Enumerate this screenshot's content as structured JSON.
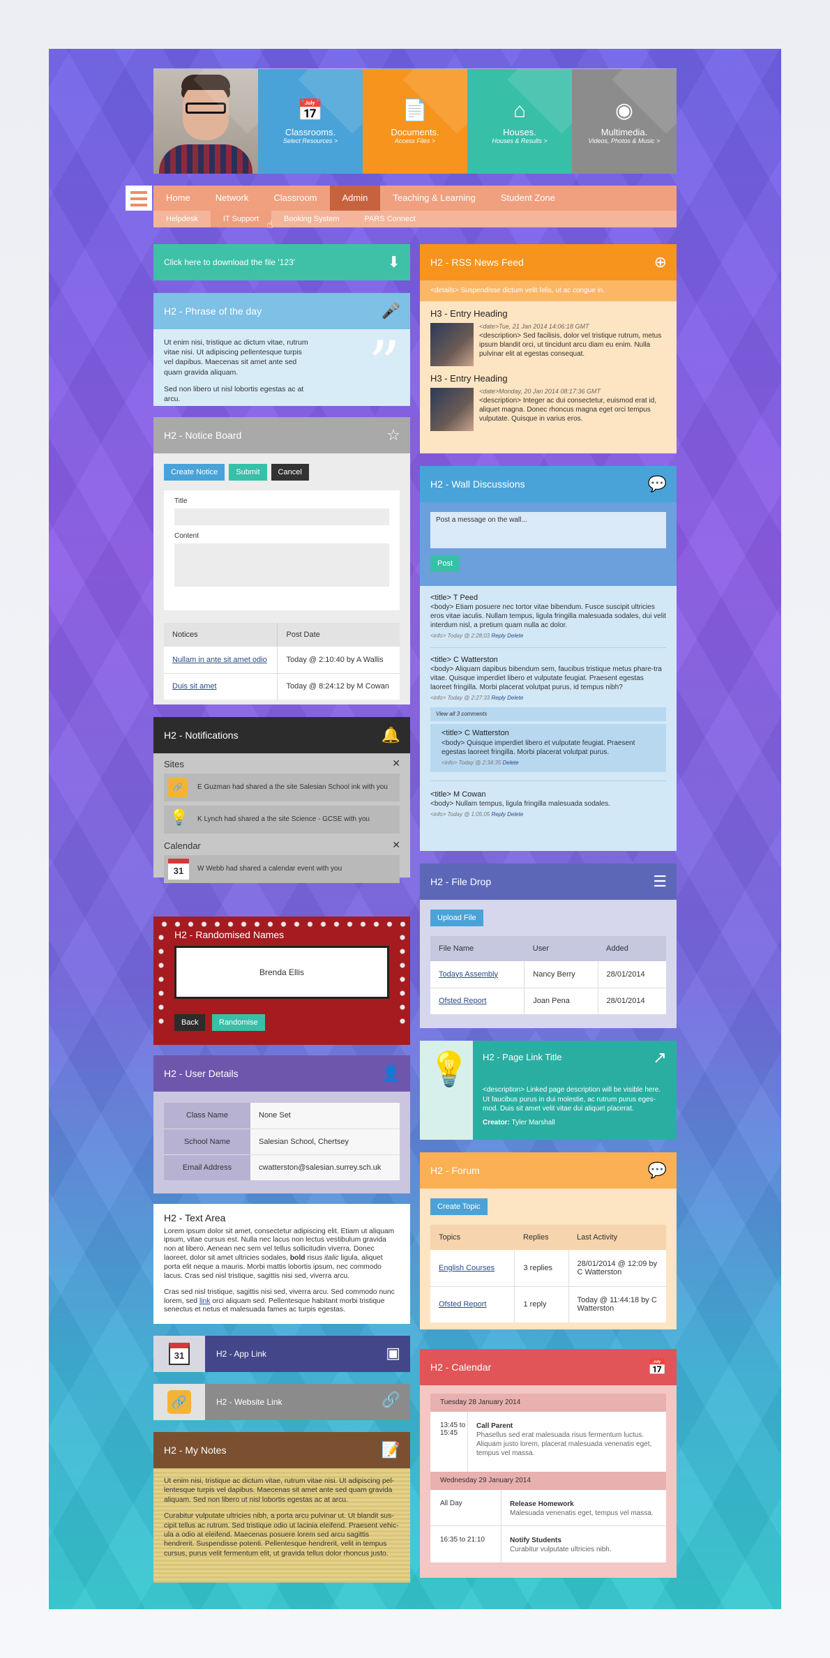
{
  "header": {
    "tiles": [
      {
        "title": "Classrooms.",
        "sub": "Select Resources >",
        "color": "#49a3d8"
      },
      {
        "title": "Documents.",
        "sub": "Access Files >",
        "color": "#f7941d"
      },
      {
        "title": "Houses.",
        "sub": "Houses & Results >",
        "color": "#38bfa8"
      },
      {
        "title": "Multimedia.",
        "sub": "Videos, Photos & Music >",
        "color": "#8c8c8c"
      }
    ]
  },
  "nav": {
    "main": [
      "Home",
      "Network",
      "Classroom",
      "Admin",
      "Teaching & Learning",
      "Student Zone"
    ],
    "sub": [
      "Helpdesk",
      "IT Support",
      "Booking System",
      "PARS Connect"
    ]
  },
  "download": {
    "label": "Click here to download the file '123'"
  },
  "phrase": {
    "title": "H2 - Phrase of the day",
    "p1": "Ut enim nisi, tristique ac dictum vitae, rutrum vitae nisi. Ut adipiscing pellentesque turpis vel dapibus. Maecenas sit amet ante sed quam gravida aliquam.",
    "p2": "Sed non libero ut nisl lobortis egestas ac at arcu."
  },
  "notice": {
    "title": "H2 - Notice Board",
    "create": "Create Notice",
    "submit": "Submit",
    "cancel": "Cancel",
    "title_label": "Title",
    "content_label": "Content",
    "cols": [
      "Notices",
      "Post Date"
    ],
    "rows": [
      [
        "Nullam in ante sit amet odio",
        "Today @ 2:10:40 by A Wallis"
      ],
      [
        "Duis sit amet",
        "Today @ 8:24:12 by M Cowan"
      ]
    ]
  },
  "notifications": {
    "title": "H2 - Notifications",
    "sites": "Sites",
    "calendar": "Calendar",
    "items": [
      "E Guzman had shared a the site Salesian School ink with you",
      "K Lynch had shared a the site Science - GCSE with you",
      "W Webb had shared a calendar event with you"
    ],
    "cal_num": "31"
  },
  "random": {
    "title": "H2 - Randomised Names",
    "name": "Brenda Ellis",
    "back": "Back",
    "randomise": "Randomise"
  },
  "user": {
    "title": "H2 - User Details",
    "rows": [
      [
        "Class Name",
        "None Set"
      ],
      [
        "School Name",
        "Salesian School, Chertsey"
      ],
      [
        "Email Address",
        "cwatterston@salesian.surrey.sch.uk"
      ]
    ]
  },
  "textarea": {
    "title": "H2 - Text Area",
    "p1a": "Lorem ipsum dolor sit amet, consectetur adipiscing elit. Etiam ut aliquam ipsum, vitae cursus est. Nulla nec lacus non lectus vestibulum gravida non at libero. Aenean nec sem vel tellus sollicitudin viverra. Donec laoreet, dolor sit amet ultricies sodales, ",
    "bold": "bold",
    "p1b": " risus ",
    "italic": "italic",
    "p1c": " ligula, aliquet porta elit neque a mauris. Morbi mattis lobortis ipsum, nec commodo lacus. Cras sed nisl tristique, sagittis nisi sed, viverra arcu.",
    "p2a": "Cras sed nisl tristique, sagittis nisi sed, viverra arcu. Sed commodo nunc lorem, sed ",
    "link": "link",
    "p2b": " orci aliquam sed. Pellentesque habitant morbi tristique senectus et netus et malesuada fames ac turpis egestas."
  },
  "applink": {
    "title": "H2 - App Link",
    "num": "31"
  },
  "weblink": {
    "title": "H2 - Website Link"
  },
  "notes": {
    "title": "H2 - My Notes",
    "p1": "Ut enim nisi, tristique ac dictum vitae, rutrum vitae nisi. Ut adipiscing pel-lentesque turpis vel dapibus. Maecenas sit amet ante sed quam gravida aliquam. Sed non libero ut nisl lobortis egestas ac at arcu.",
    "p2": "Curabitur vulputate ultricies nibh, a porta arcu pulvinar ut. Ut blandit sus-cipit tellus ac rutrum. Sed tristique odio ut lacinia eleifend. Praesent vehic-ula a odio at eleifend. Maecenas posuere lorem sed arcu sagittis hendrerit. Suspendisse potenti. Pellentesque hendrerit, velit in tempus cursus, purus velit fermentum elit, ut gravida tellus dolor rhoncus justo."
  },
  "rss": {
    "title": "H2 - RSS News Feed",
    "details": "<details> Suspendisse dictum velit felis, ut ac congue in.",
    "entries": [
      {
        "h": "H3 - Entry Heading",
        "date": "<date>Tue, 21 Jan 2014 14:06:18 GMT",
        "desc": "<description> Sed facilisis, dolor vel tristique rutrum, metus ipsum blandit orci, ut tincidunt arcu diam eu enim. Nulla pulvinar elit at egestas consequat."
      },
      {
        "h": "H3 - Entry Heading",
        "date": "<date>Monday, 20 Jan 2014 08:17:36 GMT",
        "desc": "<description> Integer ac dui consectetur, euismod erat id, aliquet magna. Donec rhoncus magna eget orci tempus vulputate. Quisque in varius eros."
      }
    ]
  },
  "wall": {
    "title": "H2 - Wall Discussions",
    "placeholder": "Post a message on the wall...",
    "post": "Post",
    "posts": [
      {
        "t": "<title> T Peed",
        "b": "<body> Etiam posuere nec tortor vitae bibendum. Fusce suscipit ultricies eros vitae iaculis. Nullam tempus, ligula fringilla malesuada sodales, dui velit interdum nisl, a pretium quam nulla ac dolor.",
        "i": "<info> Today @ 2:28:03",
        "a": "Reply Delete"
      },
      {
        "t": "<title> C Watterston",
        "b": "<body> Aliquam dapibus bibendum sem, faucibus tristique metus phare-tra vitae. Quisque imperdiet libero et vulputate feugiat. Praesent egestas laoreet fringilla. Morbi placerat volutpat purus, id tempus nibh?",
        "i": "<info> Today @ 2:27:33",
        "a": "Reply Delete"
      }
    ],
    "viewall": "View all 3 comments",
    "reply": {
      "t": "<title> C Watterston",
      "b": "<body> Quisque imperdiet libero et vulputate feugiat. Praesent egestas laoreet fringilla. Morbi placerat volutpat purus.",
      "i": "<info> Today @ 2:34:35",
      "a": "Delete"
    },
    "last": {
      "t": "<title> M Cowan",
      "b": "<body> Nullam tempus, ligula fringilla malesuada sodales.",
      "i": "<info> Today @ 1:05:05",
      "a": "Reply Delete"
    }
  },
  "filedrop": {
    "title": "H2 - File Drop",
    "upload": "Upload File",
    "cols": [
      "File Name",
      "User",
      "Added"
    ],
    "rows": [
      [
        "Todays Assembly",
        "Nancy Berry",
        "28/01/2014"
      ],
      [
        "Ofsted Report",
        "Joan Pena",
        "28/01/2014"
      ]
    ]
  },
  "pagelink": {
    "title": "H2 - Page Link Title",
    "desc": "<description> Linked page description will be visible here. Ut faucibus purus in dui molestie, ac rutrum purus eges-mod. Duis sit amet velit vitae dui aliquet placerat.",
    "creator_label": "Creator:",
    "creator": "Tyler Marshall"
  },
  "forum": {
    "title": "H2 - Forum",
    "create": "Create Topic",
    "cols": [
      "Topics",
      "Replies",
      "Last Activity"
    ],
    "rows": [
      [
        "English Courses",
        "3 replies",
        "28/01/2014 @ 12:09 by C Watterston"
      ],
      [
        "Ofsted Report",
        "1 reply",
        "Today @ 11:44:18 by C Watterston"
      ]
    ]
  },
  "calendar": {
    "title": "H2 - Calendar",
    "days": [
      {
        "d": "Tuesday 28 January 2014",
        "ev": [
          {
            "time": "13:45 to 15:45",
            "t": "Call Parent",
            "desc": "Phasellus sed erat malesuada risus fermentum luctus. Aliquam justo lorem, placerat malesuada venenatis eget, tempus vel massa."
          }
        ]
      },
      {
        "d": "Wednesday 29 January 2014",
        "ev": [
          {
            "time": "All Day",
            "t": "Release Homework",
            "desc": "Malesuada venenatis eget, tempus vel massa."
          },
          {
            "time": "16:35 to 21:10",
            "t": "Notify Students",
            "desc": "Curabitur vulputate ultricies nibh."
          }
        ]
      }
    ]
  }
}
